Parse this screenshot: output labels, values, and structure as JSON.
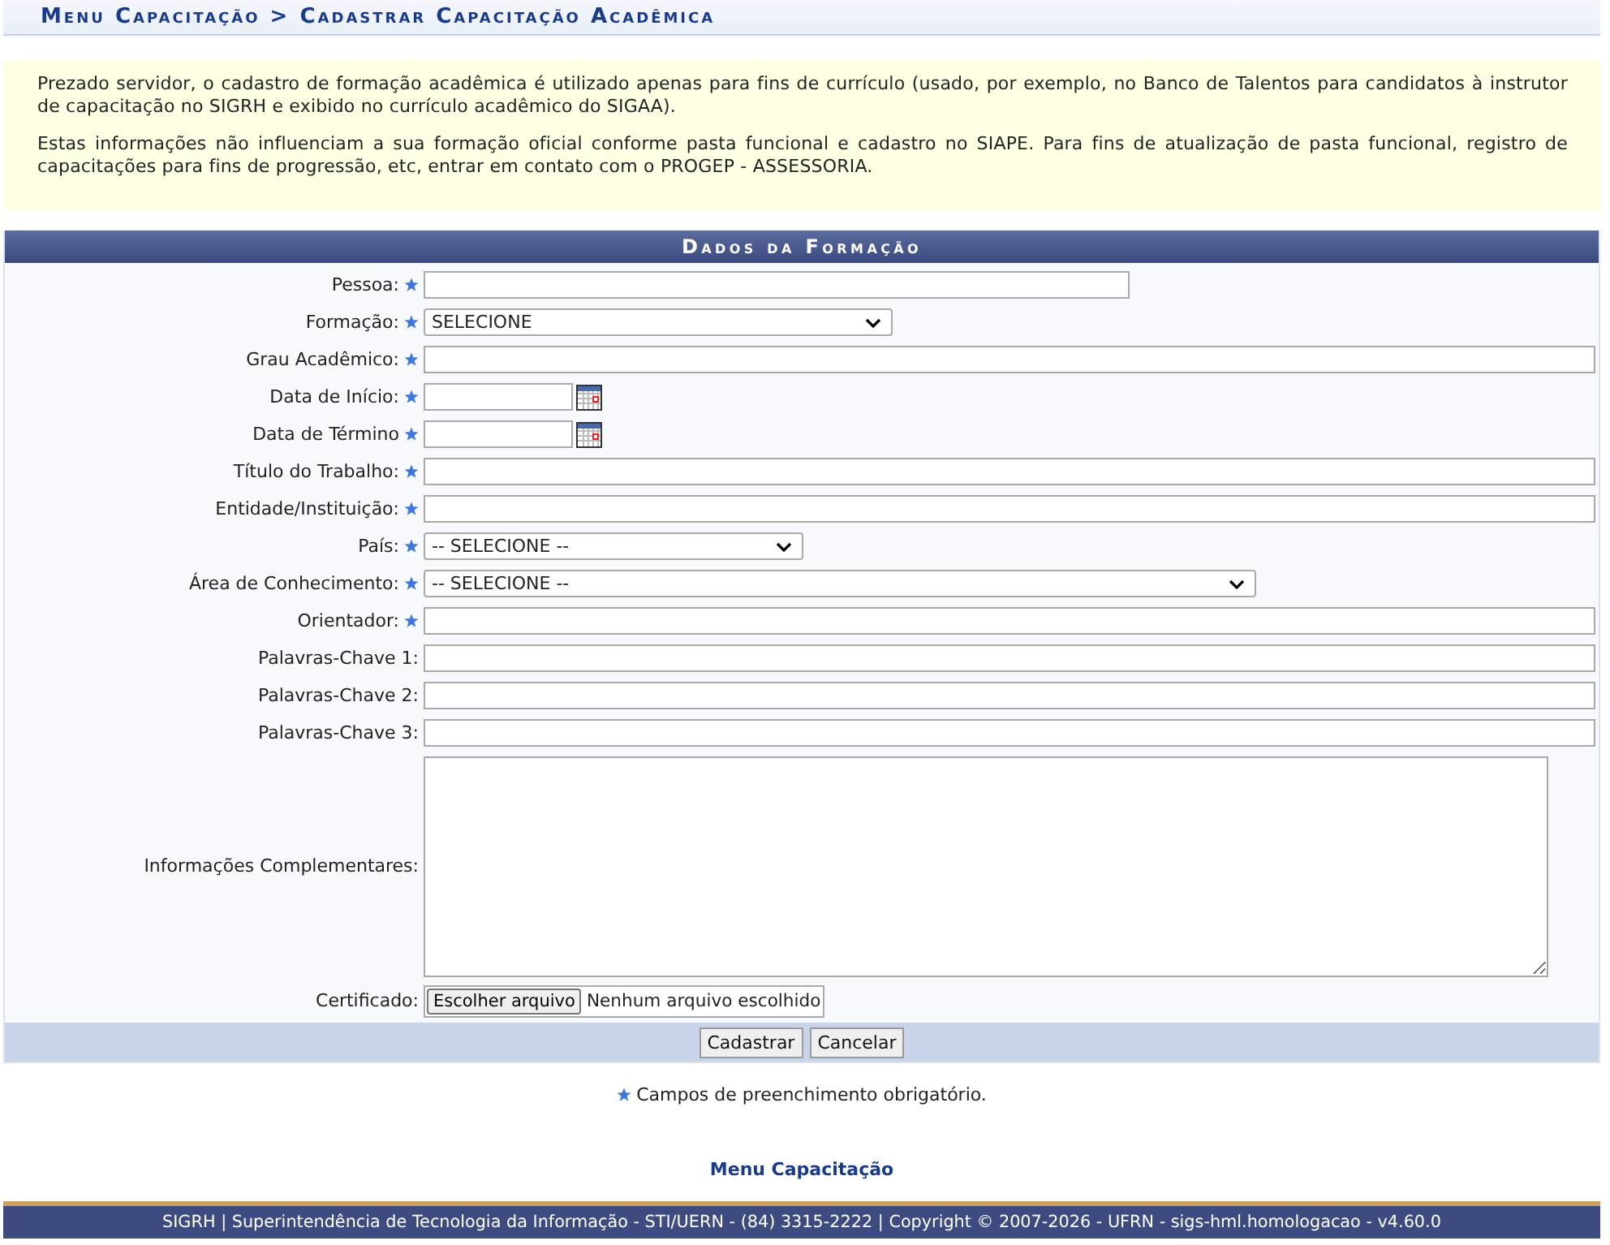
{
  "breadcrumb": "Menu Capacitação > Cadastrar Capacitação Acadêmica",
  "notice": {
    "paragraphs": [
      "Prezado servidor, o cadastro de formação acadêmica é utilizado apenas para fins de currículo (usado, por exemplo, no Banco de Talentos para candidatos à instrutor de capacitação no SIGRH e exibido no currículo acadêmico do SIGAA).",
      "Estas informações não influenciam a sua formação oficial conforme pasta funcional e cadastro no SIAPE. Para fins de atualização de pasta funcional, registro de capacitações para fins de progressão, etc, entrar em contato com o PROGEP - ASSESSORIA."
    ]
  },
  "form": {
    "title": "Dados da Formação",
    "fields": [
      {
        "label": "Pessoa:",
        "required": true,
        "kind": "text"
      },
      {
        "label": "Formação:",
        "required": true,
        "kind": "select",
        "value": "SELECIONE"
      },
      {
        "label": "Grau Acadêmico:",
        "required": true,
        "kind": "text"
      },
      {
        "label": "Data de Início:",
        "required": true,
        "kind": "date"
      },
      {
        "label": "Data de Término",
        "required": true,
        "kind": "date"
      },
      {
        "label": "Título do Trabalho:",
        "required": true,
        "kind": "text"
      },
      {
        "label": "Entidade/Instituição:",
        "required": true,
        "kind": "text"
      },
      {
        "label": "País:",
        "required": true,
        "kind": "select",
        "value": "-- SELECIONE --"
      },
      {
        "label": "Área de Conhecimento:",
        "required": true,
        "kind": "select",
        "value": "-- SELECIONE --"
      },
      {
        "label": "Orientador:",
        "required": true,
        "kind": "text"
      },
      {
        "label": "Palavras-Chave 1:",
        "required": false,
        "kind": "text"
      },
      {
        "label": "Palavras-Chave 2:",
        "required": false,
        "kind": "text"
      },
      {
        "label": "Palavras-Chave 3:",
        "required": false,
        "kind": "text"
      },
      {
        "label": "Informações Complementares:",
        "required": false,
        "kind": "textarea"
      },
      {
        "label": "Certificado:",
        "required": false,
        "kind": "file",
        "button": "Escolher arquivo",
        "status": "Nenhum arquivo escolhido"
      }
    ],
    "buttons": [
      "Cadastrar",
      "Cancelar"
    ]
  },
  "required_legend": "Campos de preenchimento obrigatório.",
  "back_link": "Menu Capacitação",
  "footer": "SIGRH | Superintendência de Tecnologia da Informação - STI/UERN - (84) 3315-2222 | Copyright © 2007-2026 - UFRN - sigs-hml.homologacao - v4.60.0"
}
